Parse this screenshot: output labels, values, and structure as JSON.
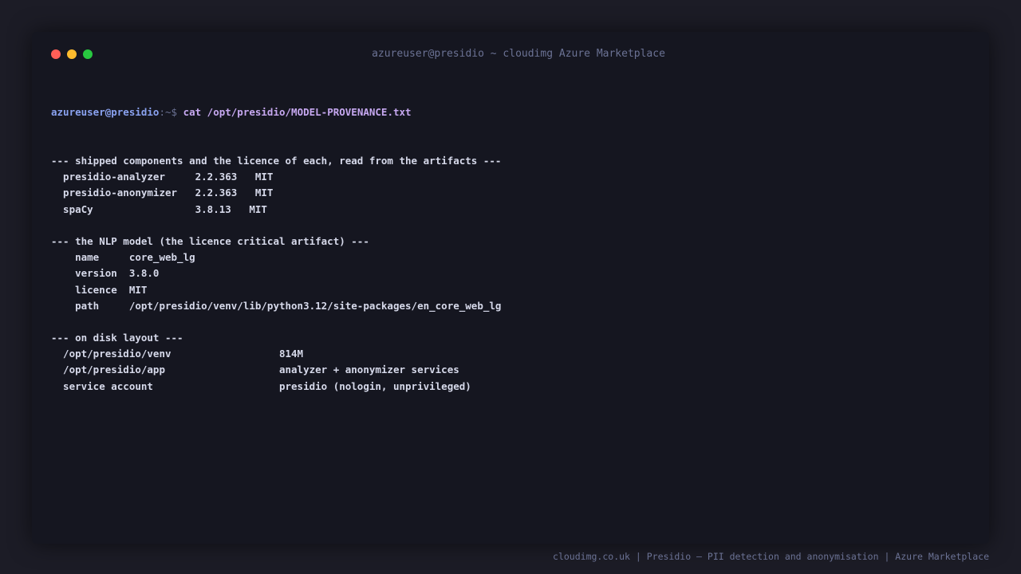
{
  "window": {
    "title": "azureuser@presidio ~ cloudimg Azure Marketplace",
    "traffic_lights": {
      "close_color": "#ff5f57",
      "minimize_color": "#febc2e",
      "maximize_color": "#28c840"
    }
  },
  "terminal": {
    "prompt_user": "azureuser@presidio",
    "prompt_sep": ":~$ ",
    "command": "cat /opt/presidio/MODEL-PROVENANCE.txt",
    "output_lines": [
      "--- shipped components and the licence of each, read from the artifacts ---",
      "  presidio-analyzer     2.2.363   MIT",
      "  presidio-anonymizer   2.2.363   MIT",
      "  spaCy                 3.8.13   MIT",
      "",
      "--- the NLP model (the licence critical artifact) ---",
      "    name     core_web_lg",
      "    version  3.8.0",
      "    licence  MIT",
      "    path     /opt/presidio/venv/lib/python3.12/site-packages/en_core_web_lg",
      "",
      "--- on disk layout ---",
      "  /opt/presidio/venv                  814M",
      "  /opt/presidio/app                   analyzer + anonymizer services",
      "  service account                     presidio (nologin, unprivileged)"
    ]
  },
  "footer": {
    "caption": "cloudimg.co.uk | Presidio — PII detection and anonymisation | Azure Marketplace"
  }
}
